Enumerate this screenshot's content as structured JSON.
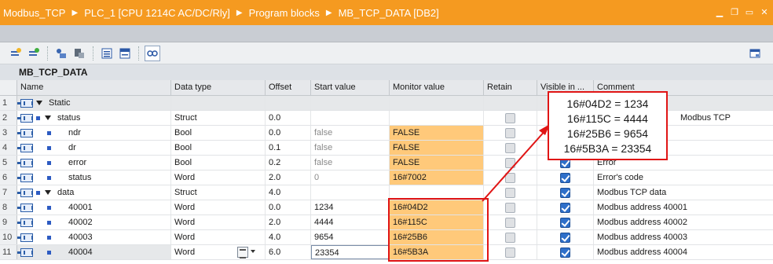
{
  "breadcrumb": [
    "Modbus_TCP",
    "PLC_1 [CPU 1214C AC/DC/Rly]",
    "Program blocks",
    "MB_TCP_DATA [DB2]"
  ],
  "block_name": "MB_TCP_DATA",
  "columns": [
    "Name",
    "Data type",
    "Offset",
    "Start value",
    "Monitor value",
    "Retain",
    "Visible in ...",
    "Comment"
  ],
  "rows": [
    {
      "num": "1",
      "name": "Static",
      "level": 0,
      "expand": true,
      "bullet": false,
      "type": "",
      "offset": "",
      "start": "",
      "monitor": "",
      "retain": "none",
      "visible": "none",
      "comment": ""
    },
    {
      "num": "2",
      "name": "status",
      "level": 1,
      "expand": true,
      "bullet": true,
      "type": "Struct",
      "offset": "0.0",
      "start": "",
      "monitor": "",
      "retain": "gray",
      "visible": "hidden",
      "comment": "Modbus TCP"
    },
    {
      "num": "3",
      "name": "ndr",
      "level": 2,
      "expand": false,
      "bullet": true,
      "type": "Bool",
      "offset": "0.0",
      "start": "false",
      "monitor": "FALSE",
      "retain": "gray",
      "visible": "hidden",
      "comment": ""
    },
    {
      "num": "4",
      "name": "dr",
      "level": 2,
      "expand": false,
      "bullet": true,
      "type": "Bool",
      "offset": "0.1",
      "start": "false",
      "monitor": "FALSE",
      "retain": "gray",
      "visible": "hidden",
      "comment": ""
    },
    {
      "num": "5",
      "name": "error",
      "level": 2,
      "expand": false,
      "bullet": true,
      "type": "Bool",
      "offset": "0.2",
      "start": "false",
      "monitor": "FALSE",
      "retain": "gray",
      "visible": "checked",
      "comment": "Error"
    },
    {
      "num": "6",
      "name": "status",
      "level": 2,
      "expand": false,
      "bullet": true,
      "type": "Word",
      "offset": "2.0",
      "start": "0",
      "monitor": "16#7002",
      "retain": "gray",
      "visible": "checked",
      "comment": "Error's code"
    },
    {
      "num": "7",
      "name": "data",
      "level": 1,
      "expand": true,
      "bullet": true,
      "type": "Struct",
      "offset": "4.0",
      "start": "",
      "monitor": "",
      "retain": "gray",
      "visible": "checked",
      "comment": "Modbus TCP data"
    },
    {
      "num": "8",
      "name": "40001",
      "level": 2,
      "expand": false,
      "bullet": true,
      "type": "Word",
      "offset": "0.0",
      "start": "1234",
      "monitor": "16#04D2",
      "retain": "gray",
      "visible": "checked",
      "comment": "Modbus address 40001"
    },
    {
      "num": "9",
      "name": "40002",
      "level": 2,
      "expand": false,
      "bullet": true,
      "type": "Word",
      "offset": "2.0",
      "start": "4444",
      "monitor": "16#115C",
      "retain": "gray",
      "visible": "checked",
      "comment": "Modbus address 40002"
    },
    {
      "num": "10",
      "name": "40003",
      "level": 2,
      "expand": false,
      "bullet": true,
      "type": "Word",
      "offset": "4.0",
      "start": "9654",
      "monitor": "16#25B6",
      "retain": "gray",
      "visible": "checked",
      "comment": "Modbus address 40003"
    },
    {
      "num": "11",
      "name": "40004",
      "level": 2,
      "expand": false,
      "bullet": true,
      "type": "Word",
      "offset": "6.0",
      "start": "23354",
      "monitor": "16#5B3A",
      "retain": "gray",
      "visible": "checked",
      "comment": "Modbus address 40004"
    }
  ],
  "callout": [
    "16#04D2 = 1234",
    "16#115C = 4444",
    "16#25B6 = 9654",
    "16#5B3A = 23354"
  ],
  "colors": {
    "titlebar": "#f59a20",
    "monitor_highlight": "#ffc97a",
    "annotation": "#e01515"
  },
  "icons": [
    "add-row-icon",
    "insert-row-icon",
    "snapshot-icon",
    "copy-values-icon",
    "expand-all-icon",
    "collapse-all-icon",
    "monitor-icon",
    "settings-icon"
  ]
}
